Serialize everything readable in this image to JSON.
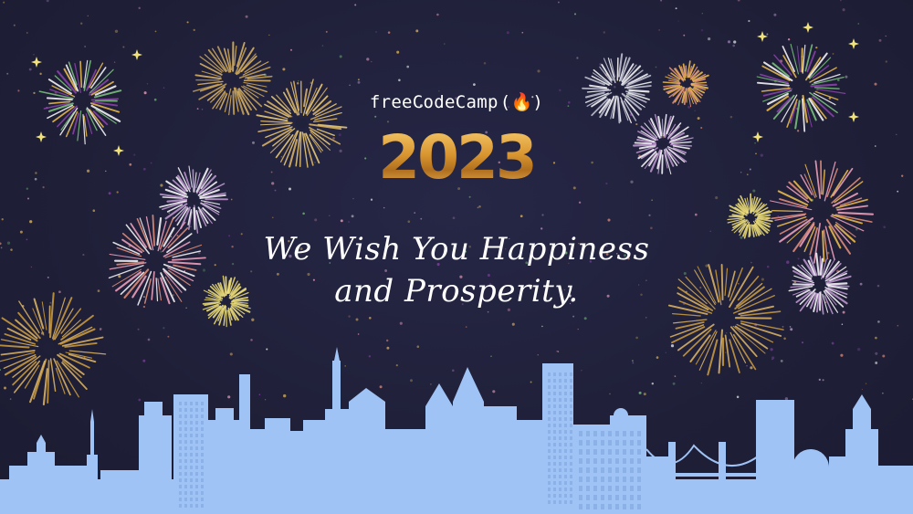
{
  "brand": {
    "name": "freeCodeCamp",
    "logo_icon": "fire-icon",
    "logo_glyph": "(🔥)"
  },
  "year": "2023",
  "greeting": {
    "line1": "We Wish You Happiness",
    "line2": "and Prosperity."
  },
  "colors": {
    "background": "#20203a",
    "skyline": "#9fc3f5",
    "gold": "#d99a3e",
    "text": "#ffffff",
    "firework_palette": [
      "#f2c14e",
      "#7fc97f",
      "#8e44ad",
      "#f7a6c1",
      "#ffffff",
      "#e1b866",
      "#c39bd3",
      "#e8927c"
    ]
  }
}
